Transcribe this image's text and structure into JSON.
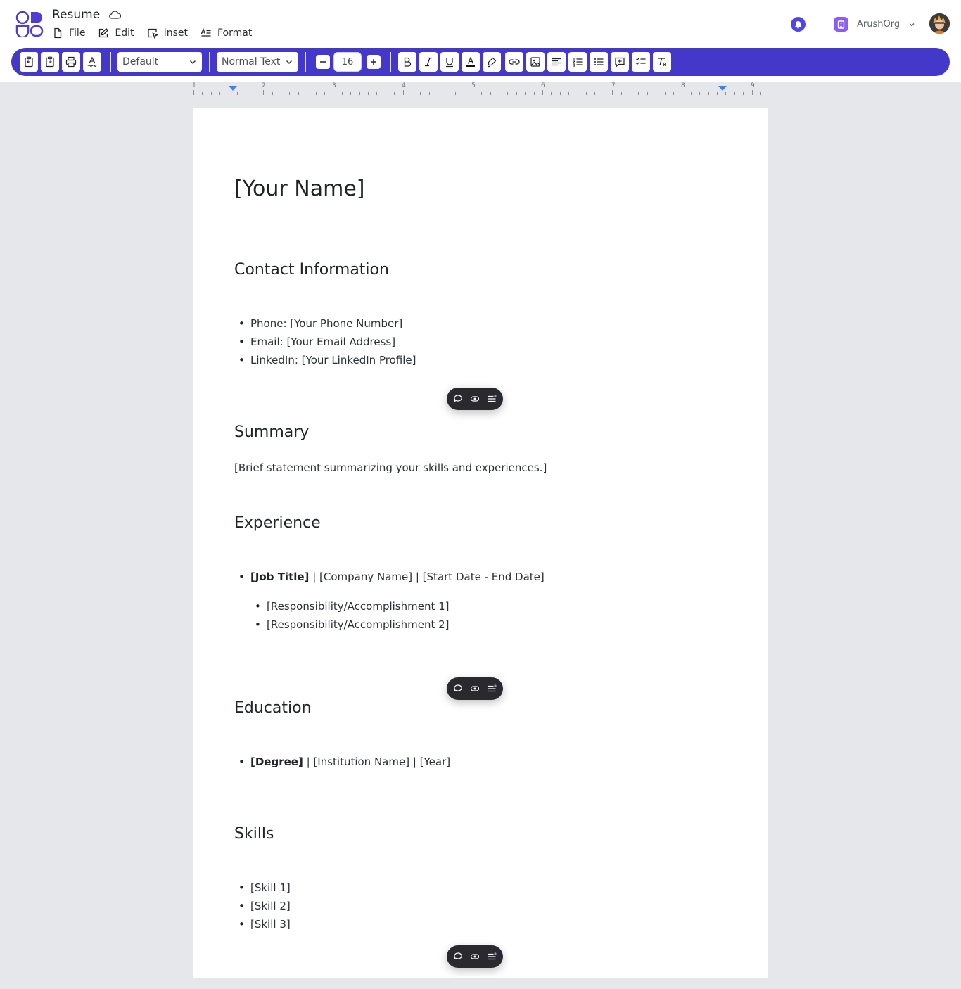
{
  "app": {
    "doc_title": "Resume",
    "menus": [
      {
        "label": "File",
        "icon": "file-icon"
      },
      {
        "label": "Edit",
        "icon": "edit-icon"
      },
      {
        "label": "Inset",
        "icon": "insert-icon"
      },
      {
        "label": "Format",
        "icon": "format-icon"
      }
    ],
    "org_name": "ArushOrg"
  },
  "toolbar": {
    "font_family": "Default",
    "text_style": "Normal Text",
    "font_size": "16",
    "accent_color": "#4338ca"
  },
  "ruler": {
    "numbers": [
      "1",
      "2",
      "3",
      "4",
      "5",
      "6",
      "7",
      "8",
      "9"
    ]
  },
  "document": {
    "name_heading": "[Your Name]",
    "contact": {
      "heading": "Contact Information",
      "items": [
        "Phone: [Your Phone Number]",
        "Email: [Your Email Address]",
        "LinkedIn: [Your LinkedIn Profile]"
      ]
    },
    "summary": {
      "heading": "Summary",
      "text": "[Brief statement summarizing your skills and experiences.]"
    },
    "experience": {
      "heading": "Experience",
      "job_title": "[Job Title]",
      "job_rest": " | [Company Name] | [Start Date - End Date]",
      "sub_items": [
        "[Responsibility/Accomplishment 1]",
        "[Responsibility/Accomplishment 2]"
      ]
    },
    "education": {
      "heading": "Education",
      "degree": "[Degree]",
      "degree_rest": " | [Institution Name] | [Year]"
    },
    "skills": {
      "heading": "Skills",
      "items": [
        "[Skill 1]",
        "[Skill 2]",
        "[Skill 3]"
      ]
    }
  }
}
